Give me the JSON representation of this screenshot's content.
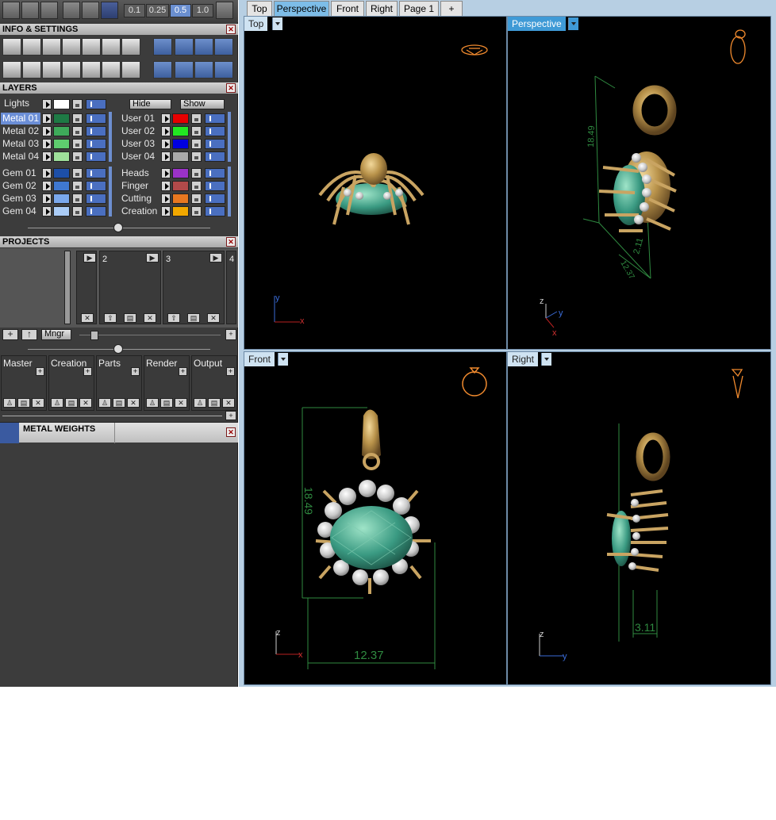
{
  "toolbar": {
    "snap_values": [
      "0.1",
      "0.25",
      "0.5",
      "1.0"
    ],
    "active_snap": "0.5",
    "icons": [
      "view-grid-icon",
      "cube-view-icon",
      "wand-icon",
      "hatch-icon",
      "eraser-icon",
      "axis-icon",
      "grid-toggle-icon"
    ]
  },
  "panels": {
    "info": "INFO & SETTINGS",
    "layers": "LAYERS",
    "projects": "PROJECTS",
    "metal_weights": "METAL WEIGHTS"
  },
  "layers": {
    "lights": "Lights",
    "hide": "Hide",
    "show": "Show",
    "left": [
      {
        "name": "Metal 01",
        "color": "#1e7a45",
        "selected": true
      },
      {
        "name": "Metal 02",
        "color": "#3eaa5a"
      },
      {
        "name": "Metal 03",
        "color": "#5ecc6e"
      },
      {
        "name": "Metal 04",
        "color": "#9ee09a"
      },
      {
        "name": "Gem 01",
        "color": "#1d4fa8"
      },
      {
        "name": "Gem 02",
        "color": "#3f78d0"
      },
      {
        "name": "Gem 03",
        "color": "#7aa8ec"
      },
      {
        "name": "Gem 04",
        "color": "#aaccf6"
      }
    ],
    "right": [
      {
        "name": "User 01",
        "color": "#e60000"
      },
      {
        "name": "User 02",
        "color": "#22e822"
      },
      {
        "name": "User 03",
        "color": "#0000e0"
      },
      {
        "name": "User 04",
        "color": "#aaaaaa"
      },
      {
        "name": "Heads",
        "color": "#9b32c8"
      },
      {
        "name": "Finger",
        "color": "#b24a4a"
      },
      {
        "name": "Cutting",
        "color": "#e87820"
      },
      {
        "name": "Creation",
        "color": "#f2a800"
      }
    ]
  },
  "projects": {
    "slots": [
      "2",
      "3",
      "4"
    ],
    "mngr": "Mngr"
  },
  "categories": [
    "Master",
    "Creation",
    "Parts",
    "Render",
    "Output"
  ],
  "tabs": [
    "Top",
    "Perspective",
    "Front",
    "Right",
    "Page 1",
    "+"
  ],
  "active_tab": "Perspective",
  "viewports": {
    "top": {
      "label": "Top"
    },
    "perspective": {
      "label": "Perspective",
      "dims": [
        "18.49",
        "2.11",
        "12.37"
      ]
    },
    "front": {
      "label": "Front",
      "dims": [
        "18.49",
        "12.37"
      ]
    },
    "right": {
      "label": "Right",
      "dims": [
        "3.11"
      ]
    }
  },
  "axes": {
    "x": "x",
    "y": "y",
    "z": "z"
  }
}
